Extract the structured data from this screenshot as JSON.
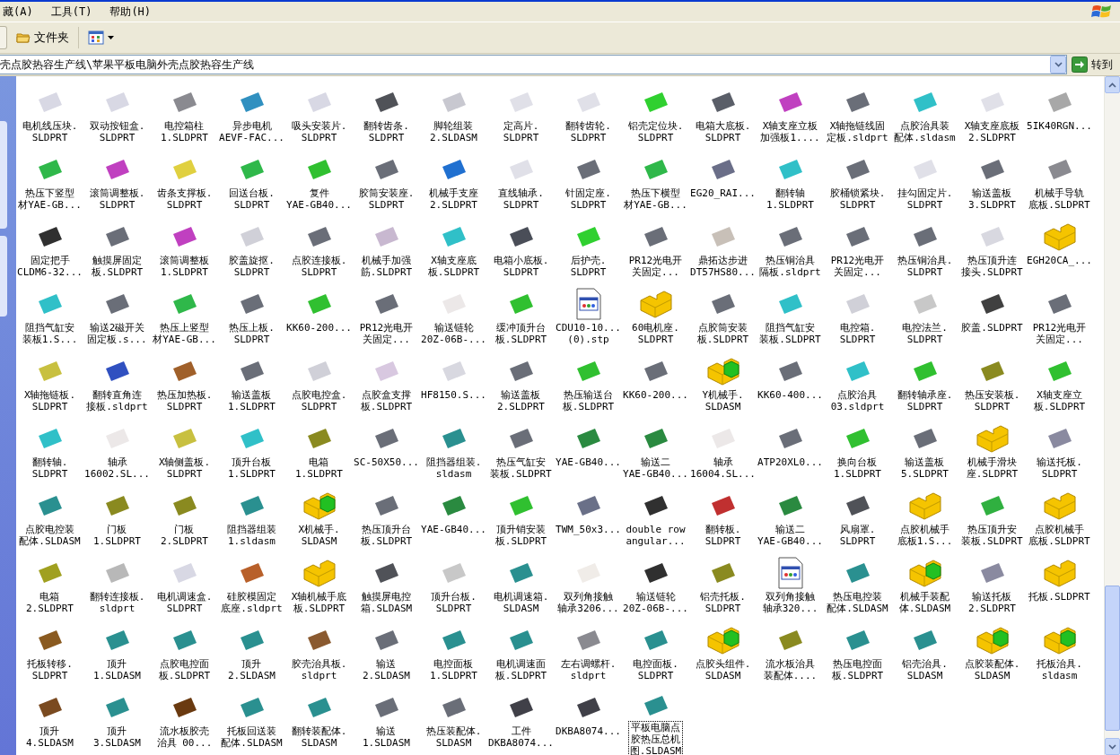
{
  "menu": [
    "藏(A)",
    "工具(T)",
    "帮助(H)"
  ],
  "toolbar": {
    "folders_label": "文件夹"
  },
  "address": {
    "value": "壳点胶热容生产线\\苹果平板电脑外壳点胶热容生产线",
    "go_label": "转到"
  },
  "files": [
    {
      "kind": "part",
      "color": "#d8d8e4",
      "lines": [
        "电机线压块.",
        "SLDPRT"
      ],
      "selected": false
    },
    {
      "kind": "part",
      "color": "#d8d8e4",
      "lines": [
        "双动按钮盒.",
        "SLDPRT"
      ],
      "selected": false
    },
    {
      "kind": "part",
      "color": "#8a8a90",
      "lines": [
        "电控箱柱",
        "1.SLDPRT"
      ],
      "selected": false
    },
    {
      "kind": "part",
      "color": "#3090c0",
      "lines": [
        "异步电机",
        "AEVF-FAC..."
      ],
      "selected": false
    },
    {
      "kind": "part",
      "color": "#d8d8e4",
      "lines": [
        "吸头安装片.",
        "SLDPRT"
      ],
      "selected": false
    },
    {
      "kind": "part",
      "color": "#505258",
      "lines": [
        "翻转齿条.",
        "SLDPRT"
      ],
      "selected": false
    },
    {
      "kind": "part",
      "color": "#c8c8d0",
      "lines": [
        "脚轮组装",
        "2.SLDASM"
      ],
      "selected": false
    },
    {
      "kind": "part",
      "color": "#e0e0e8",
      "lines": [
        "定高片.",
        "SLDPRT"
      ],
      "selected": false
    },
    {
      "kind": "part",
      "color": "#e0e0e8",
      "lines": [
        "翻转齿轮.",
        "SLDPRT"
      ],
      "selected": false
    },
    {
      "kind": "part",
      "color": "#30d030",
      "lines": [
        "铝壳定位块.",
        "SLDPRT"
      ],
      "selected": false
    },
    {
      "kind": "part",
      "color": "#5a5e68",
      "lines": [
        "电箱大底板.",
        "SLDPRT"
      ],
      "selected": false
    },
    {
      "kind": "part",
      "color": "#c040c0",
      "lines": [
        "X轴支座立板",
        "加强板1...."
      ],
      "selected": false
    },
    {
      "kind": "part",
      "color": "#6a6e78",
      "lines": [
        "X轴拖链线固",
        "定板.sldprt"
      ],
      "selected": false
    },
    {
      "kind": "part",
      "color": "#30c0c8",
      "lines": [
        "点胶治具装",
        "配体.sldasm"
      ],
      "selected": false
    },
    {
      "kind": "part",
      "color": "#e0e0e8",
      "lines": [
        "X轴支座底板",
        "2.SLDPRT"
      ],
      "selected": false
    },
    {
      "kind": "part",
      "color": "#a8a8a8",
      "lines": [
        "5IK40RGN..."
      ],
      "selected": false
    },
    {
      "kind": "part",
      "color": "#2fb84a",
      "lines": [
        "热压下竖型",
        "材YAE-GB..."
      ],
      "selected": false
    },
    {
      "kind": "part",
      "color": "#c040c0",
      "lines": [
        "滚筒调整板.",
        "SLDPRT"
      ],
      "selected": false
    },
    {
      "kind": "part",
      "color": "#e0d040",
      "lines": [
        "齿条支撑板.",
        "SLDPRT"
      ],
      "selected": false
    },
    {
      "kind": "part",
      "color": "#2fb84a",
      "lines": [
        "回送台板.",
        "SLDPRT"
      ],
      "selected": false
    },
    {
      "kind": "part",
      "color": "#30c030",
      "lines": [
        "复件",
        "YAE-GB40..."
      ],
      "selected": false
    },
    {
      "kind": "part",
      "color": "#6a6e78",
      "lines": [
        "胶筒安装座.",
        "SLDPRT"
      ],
      "selected": false
    },
    {
      "kind": "part",
      "color": "#2070d0",
      "lines": [
        "机械手支座",
        "2.SLDPRT"
      ],
      "selected": false
    },
    {
      "kind": "part",
      "color": "#e0e0e8",
      "lines": [
        "直线轴承.",
        "SLDPRT"
      ],
      "selected": false
    },
    {
      "kind": "part",
      "color": "#6a6e78",
      "lines": [
        "针固定座.",
        "SLDPRT"
      ],
      "selected": false
    },
    {
      "kind": "part",
      "color": "#2fb84a",
      "lines": [
        "热压下横型",
        "材YAE-GB..."
      ],
      "selected": false
    },
    {
      "kind": "part",
      "color": "#6a6e88",
      "lines": [
        "EG20_RAI..."
      ],
      "selected": false
    },
    {
      "kind": "part",
      "color": "#30c0c8",
      "lines": [
        "翻转轴",
        "1.SLDPRT"
      ],
      "selected": false
    },
    {
      "kind": "part",
      "color": "#6a6e78",
      "lines": [
        "胶桶锁紧块.",
        "SLDPRT"
      ],
      "selected": false
    },
    {
      "kind": "part",
      "color": "#e0e0e8",
      "lines": [
        "挂勾固定片.",
        "SLDPRT"
      ],
      "selected": false
    },
    {
      "kind": "part",
      "color": "#6a6e78",
      "lines": [
        "输送盖板",
        "3.SLDPRT"
      ],
      "selected": false
    },
    {
      "kind": "part",
      "color": "#8a8a90",
      "lines": [
        "机械手导轨",
        "底板.SLDPRT"
      ],
      "selected": false
    },
    {
      "kind": "part",
      "color": "#303030",
      "lines": [
        "固定把手",
        "CLDM6-32..."
      ],
      "selected": false
    },
    {
      "kind": "part",
      "color": "#6a6e78",
      "lines": [
        "触摸屏固定",
        "板.SLDPRT"
      ],
      "selected": false
    },
    {
      "kind": "part",
      "color": "#c040c0",
      "lines": [
        "滚筒调整板",
        "1.SLDPRT"
      ],
      "selected": false
    },
    {
      "kind": "part",
      "color": "#d0d0d8",
      "lines": [
        "胶盖旋抠.",
        "SLDPRT"
      ],
      "selected": false
    },
    {
      "kind": "part",
      "color": "#6a6e78",
      "lines": [
        "点胶连接板.",
        "SLDPRT"
      ],
      "selected": false
    },
    {
      "kind": "part",
      "color": "#c8b8d0",
      "lines": [
        "机械手加强",
        "筋.SLDPRT"
      ],
      "selected": false
    },
    {
      "kind": "part",
      "color": "#30c0c8",
      "lines": [
        "X轴支座底",
        "板.SLDPRT"
      ],
      "selected": false
    },
    {
      "kind": "part",
      "color": "#4a4e58",
      "lines": [
        "电箱小底板.",
        "SLDPRT"
      ],
      "selected": false
    },
    {
      "kind": "part",
      "color": "#30d030",
      "lines": [
        "后护壳.",
        "SLDPRT"
      ],
      "selected": false
    },
    {
      "kind": "part",
      "color": "#6a6e78",
      "lines": [
        "PR12光电开",
        "关固定..."
      ],
      "selected": false
    },
    {
      "kind": "part",
      "color": "#c8c0b8",
      "lines": [
        "鼎拓达步进",
        "DT57HS80..."
      ],
      "selected": false
    },
    {
      "kind": "part",
      "color": "#6a6e78",
      "lines": [
        "热压铜治具",
        "隔板.sldprt"
      ],
      "selected": false
    },
    {
      "kind": "part",
      "color": "#6a6e78",
      "lines": [
        "PR12光电开",
        "关固定..."
      ],
      "selected": false
    },
    {
      "kind": "part",
      "color": "#6a6e78",
      "lines": [
        "热压铜治具.",
        "SLDPRT"
      ],
      "selected": false
    },
    {
      "kind": "part",
      "color": "#d8d8e0",
      "lines": [
        "热压顶升连",
        "接头.SLDPRT"
      ],
      "selected": false
    },
    {
      "kind": "block",
      "lines": [
        "EGH20CA_..."
      ],
      "selected": false
    },
    {
      "kind": "part",
      "color": "#30c0c8",
      "lines": [
        "阻挡气缸安",
        "装板1.S..."
      ],
      "selected": false
    },
    {
      "kind": "part",
      "color": "#6a6e78",
      "lines": [
        "输送2磁开关",
        "固定板.s..."
      ],
      "selected": false
    },
    {
      "kind": "part",
      "color": "#2fb84a",
      "lines": [
        "热压上竖型",
        "材YAE-GB..."
      ],
      "selected": false
    },
    {
      "kind": "part",
      "color": "#6a6e78",
      "lines": [
        "热压上板.",
        "SLDPRT"
      ],
      "selected": false
    },
    {
      "kind": "part",
      "color": "#30c030",
      "lines": [
        "KK60-200..."
      ],
      "selected": false
    },
    {
      "kind": "part",
      "color": "#6a6e78",
      "lines": [
        "PR12光电开",
        "关固定..."
      ],
      "selected": false
    },
    {
      "kind": "part",
      "color": "#ece8e8",
      "lines": [
        "输送链轮",
        "20Z-06B-..."
      ],
      "selected": false
    },
    {
      "kind": "part",
      "color": "#30c030",
      "lines": [
        "缓冲顶升台",
        "板.SLDPRT"
      ],
      "selected": false
    },
    {
      "kind": "document",
      "lines": [
        "CDU10-10...",
        "(0).stp"
      ],
      "selected": false
    },
    {
      "kind": "block",
      "lines": [
        "60电机座.",
        "SLDPRT"
      ],
      "selected": false
    },
    {
      "kind": "part",
      "color": "#6a6e78",
      "lines": [
        "点胶筒安装",
        "板.SLDPRT"
      ],
      "selected": false
    },
    {
      "kind": "part",
      "color": "#30c0c8",
      "lines": [
        "阻挡气缸安",
        "装板.SLDPRT"
      ],
      "selected": false
    },
    {
      "kind": "part",
      "color": "#d0d0d8",
      "lines": [
        "电控箱.",
        "SLDPRT"
      ],
      "selected": false
    },
    {
      "kind": "part",
      "color": "#c8c8c8",
      "lines": [
        "电控法兰.",
        "SLDPRT"
      ],
      "selected": false
    },
    {
      "kind": "part",
      "color": "#404040",
      "lines": [
        "胶盖.SLDPRT"
      ],
      "selected": false
    },
    {
      "kind": "part",
      "color": "#6a6e78",
      "lines": [
        "PR12光电开",
        "关固定..."
      ],
      "selected": false
    },
    {
      "kind": "part",
      "color": "#c8c040",
      "lines": [
        "X轴拖链板.",
        "SLDPRT"
      ],
      "selected": false
    },
    {
      "kind": "part",
      "color": "#3050c0",
      "lines": [
        "翻转直角连",
        "接板.sldprt"
      ],
      "selected": false
    },
    {
      "kind": "part",
      "color": "#a0602a",
      "lines": [
        "热压加热板.",
        "SLDPRT"
      ],
      "selected": false
    },
    {
      "kind": "part",
      "color": "#6a6e78",
      "lines": [
        "输送盖板",
        "1.SLDPRT"
      ],
      "selected": false
    },
    {
      "kind": "part",
      "color": "#d0d0d8",
      "lines": [
        "点胶电控盒.",
        "SLDPRT"
      ],
      "selected": false
    },
    {
      "kind": "part",
      "color": "#d8c8e0",
      "lines": [
        "点胶盒支撑",
        "板.SLDPRT"
      ],
      "selected": false
    },
    {
      "kind": "part",
      "color": "#d8d8e0",
      "lines": [
        "HF8150.S..."
      ],
      "selected": false
    },
    {
      "kind": "part",
      "color": "#6a6e78",
      "lines": [
        "输送盖板",
        "2.SLDPRT"
      ],
      "selected": false
    },
    {
      "kind": "part",
      "color": "#30c030",
      "lines": [
        "热压输送台",
        "板.SLDPRT"
      ],
      "selected": false
    },
    {
      "kind": "part",
      "color": "#6a6e78",
      "lines": [
        "KK60-200..."
      ],
      "selected": false
    },
    {
      "kind": "assembly",
      "lines": [
        "Y机械手.",
        "SLDASM"
      ],
      "selected": false
    },
    {
      "kind": "part",
      "color": "#6a6e78",
      "lines": [
        "KK60-400..."
      ],
      "selected": false
    },
    {
      "kind": "part",
      "color": "#30c0c8",
      "lines": [
        "点胶治具",
        "03.sldprt"
      ],
      "selected": false
    },
    {
      "kind": "part",
      "color": "#30c030",
      "lines": [
        "翻转轴承座.",
        "SLDPRT"
      ],
      "selected": false
    },
    {
      "kind": "part",
      "color": "#8a8a20",
      "lines": [
        "热压安装板.",
        "SLDPRT"
      ],
      "selected": false
    },
    {
      "kind": "part",
      "color": "#30c030",
      "lines": [
        "X轴支座立",
        "板.SLDPRT"
      ],
      "selected": false
    },
    {
      "kind": "part",
      "color": "#30c0c8",
      "lines": [
        "翻转轴.",
        "SLDPRT"
      ],
      "selected": false
    },
    {
      "kind": "part",
      "color": "#ece8e8",
      "lines": [
        "轴承",
        "16002.SL..."
      ],
      "selected": false
    },
    {
      "kind": "part",
      "color": "#c8c040",
      "lines": [
        "X轴侧盖板.",
        "SLDPRT"
      ],
      "selected": false
    },
    {
      "kind": "part",
      "color": "#30c0c8",
      "lines": [
        "顶升台板",
        "1.SLDPRT"
      ],
      "selected": false
    },
    {
      "kind": "part",
      "color": "#8a8a20",
      "lines": [
        "电箱",
        "1.SLDPRT"
      ],
      "selected": false
    },
    {
      "kind": "part",
      "color": "#6a6e78",
      "lines": [
        "SC-50X50..."
      ],
      "selected": false
    },
    {
      "kind": "part",
      "color": "#2a9090",
      "lines": [
        "阻挡器组装.",
        "sldasm"
      ],
      "selected": false
    },
    {
      "kind": "part",
      "color": "#6a6e78",
      "lines": [
        "热压气缸安",
        "装板.SLDPRT"
      ],
      "selected": false
    },
    {
      "kind": "part",
      "color": "#2a8a40",
      "lines": [
        "YAE-GB40..."
      ],
      "selected": false
    },
    {
      "kind": "part",
      "color": "#2a8a40",
      "lines": [
        "输送二",
        "YAE-GB40..."
      ],
      "selected": false
    },
    {
      "kind": "part",
      "color": "#ece8e8",
      "lines": [
        "轴承",
        "16004.SL..."
      ],
      "selected": false
    },
    {
      "kind": "part",
      "color": "#6a6e78",
      "lines": [
        "ATP20XL0..."
      ],
      "selected": false
    },
    {
      "kind": "part",
      "color": "#30c030",
      "lines": [
        "换向台板",
        "1.SLDPRT"
      ],
      "selected": false
    },
    {
      "kind": "part",
      "color": "#6a6e78",
      "lines": [
        "输送盖板",
        "5.SLDPRT"
      ],
      "selected": false
    },
    {
      "kind": "block",
      "lines": [
        "机械手滑块",
        "座.SLDPRT"
      ],
      "selected": false
    },
    {
      "kind": "part",
      "color": "#8a8aa0",
      "lines": [
        "输送托板.",
        "SLDPRT"
      ],
      "selected": false
    },
    {
      "kind": "part",
      "color": "#2a9090",
      "lines": [
        "点胶电控装",
        "配体.SLDASM"
      ],
      "selected": false
    },
    {
      "kind": "part",
      "color": "#8a8a20",
      "lines": [
        "门板",
        "1.SLDPRT"
      ],
      "selected": false
    },
    {
      "kind": "part",
      "color": "#8a8a20",
      "lines": [
        "门板",
        "2.SLDPRT"
      ],
      "selected": false
    },
    {
      "kind": "part",
      "color": "#2a9090",
      "lines": [
        "阻挡器组装",
        "1.sldasm"
      ],
      "selected": false
    },
    {
      "kind": "assembly",
      "lines": [
        "X机械手.",
        "SLDASM"
      ],
      "selected": false
    },
    {
      "kind": "part",
      "color": "#6a6e78",
      "lines": [
        "热压顶升台",
        "板.SLDPRT"
      ],
      "selected": false
    },
    {
      "kind": "part",
      "color": "#2a8a40",
      "lines": [
        "YAE-GB40..."
      ],
      "selected": false
    },
    {
      "kind": "part",
      "color": "#30c030",
      "lines": [
        "顶升销安装",
        "板.SLDPRT"
      ],
      "selected": false
    },
    {
      "kind": "part",
      "color": "#6a7088",
      "lines": [
        "TWM_50x3..."
      ],
      "selected": false
    },
    {
      "kind": "part",
      "color": "#303030",
      "lines": [
        "double row",
        "angular..."
      ],
      "selected": false
    },
    {
      "kind": "part",
      "color": "#c03030",
      "lines": [
        "翻转板.",
        "SLDPRT"
      ],
      "selected": false
    },
    {
      "kind": "part",
      "color": "#2a8a40",
      "lines": [
        "输送二",
        "YAE-GB40..."
      ],
      "selected": false
    },
    {
      "kind": "part",
      "color": "#505258",
      "lines": [
        "风扇罩.",
        "SLDPRT"
      ],
      "selected": false
    },
    {
      "kind": "block",
      "lines": [
        "点胶机械手",
        "底板1.S..."
      ],
      "selected": false
    },
    {
      "kind": "part",
      "color": "#30b040",
      "lines": [
        "热压顶升安",
        "装板.SLDPRT"
      ],
      "selected": false
    },
    {
      "kind": "block",
      "lines": [
        "点胶机械手",
        "底板.SLDPRT"
      ],
      "selected": false
    },
    {
      "kind": "part",
      "color": "#a0a020",
      "lines": [
        "电箱",
        "2.SLDPRT"
      ],
      "selected": false
    },
    {
      "kind": "part",
      "color": "#b8b8b8",
      "lines": [
        "翻转连接板.",
        "sldprt"
      ],
      "selected": false
    },
    {
      "kind": "part",
      "color": "#d8d8e4",
      "lines": [
        "电机调速盒.",
        "SLDPRT"
      ],
      "selected": false
    },
    {
      "kind": "part",
      "color": "#b8602a",
      "lines": [
        "硅胶模固定",
        "底座.sldprt"
      ],
      "selected": false
    },
    {
      "kind": "block",
      "lines": [
        "X轴机械手底",
        "板.SLDPRT"
      ],
      "selected": false
    },
    {
      "kind": "part",
      "color": "#505258",
      "lines": [
        "触摸屏电控",
        "箱.SLDASM"
      ],
      "selected": false
    },
    {
      "kind": "part",
      "color": "#c8c8c8",
      "lines": [
        "顶升台板.",
        "SLDPRT"
      ],
      "selected": false
    },
    {
      "kind": "part",
      "color": "#2a9090",
      "lines": [
        "电机调速箱.",
        "SLDASM"
      ],
      "selected": false
    },
    {
      "kind": "part",
      "color": "#f0ece8",
      "lines": [
        "双列角接触",
        "轴承3206..."
      ],
      "selected": false
    },
    {
      "kind": "part",
      "color": "#303030",
      "lines": [
        "输送链轮",
        "20Z-06B-..."
      ],
      "selected": false
    },
    {
      "kind": "part",
      "color": "#8a8a20",
      "lines": [
        "铝壳托板.",
        "SLDPRT"
      ],
      "selected": false
    },
    {
      "kind": "document",
      "lines": [
        "双列角接触",
        "轴承320..."
      ],
      "selected": false
    },
    {
      "kind": "part",
      "color": "#2a9090",
      "lines": [
        "热压电控装",
        "配体.SLDASM"
      ],
      "selected": false
    },
    {
      "kind": "assembly",
      "lines": [
        "机械手装配",
        "体.SLDASM"
      ],
      "selected": false
    },
    {
      "kind": "part",
      "color": "#8a8aa0",
      "lines": [
        "输送托板",
        "2.SLDPRT"
      ],
      "selected": false
    },
    {
      "kind": "block",
      "lines": [
        "托板.SLDPRT"
      ],
      "selected": false
    },
    {
      "kind": "part",
      "color": "#8a5a20",
      "lines": [
        "托板转移.",
        "SLDPRT"
      ],
      "selected": false
    },
    {
      "kind": "part",
      "color": "#2a9090",
      "lines": [
        "顶升",
        "1.SLDASM"
      ],
      "selected": false
    },
    {
      "kind": "part",
      "color": "#2a9090",
      "lines": [
        "点胶电控面",
        "板.SLDPRT"
      ],
      "selected": false
    },
    {
      "kind": "part",
      "color": "#2a9090",
      "lines": [
        "顶升",
        "2.SLDASM"
      ],
      "selected": false
    },
    {
      "kind": "part",
      "color": "#8a5a30",
      "lines": [
        "胶壳治具板.",
        "sldprt"
      ],
      "selected": false
    },
    {
      "kind": "part",
      "color": "#6a6e78",
      "lines": [
        "输送",
        "2.SLDASM"
      ],
      "selected": false
    },
    {
      "kind": "part",
      "color": "#2a9090",
      "lines": [
        "电控面板",
        "1.SLDPRT"
      ],
      "selected": false
    },
    {
      "kind": "part",
      "color": "#2a9090",
      "lines": [
        "电机调速面",
        "板.SLDPRT"
      ],
      "selected": false
    },
    {
      "kind": "part",
      "color": "#8a8a90",
      "lines": [
        "左右调螺杆.",
        "sldprt"
      ],
      "selected": false
    },
    {
      "kind": "part",
      "color": "#2a9090",
      "lines": [
        "电控面板.",
        "SLDPRT"
      ],
      "selected": false
    },
    {
      "kind": "assembly",
      "lines": [
        "点胶头组件.",
        "SLDASM"
      ],
      "selected": false
    },
    {
      "kind": "part",
      "color": "#8a8a20",
      "lines": [
        "流水板治具",
        "装配体...."
      ],
      "selected": false
    },
    {
      "kind": "part",
      "color": "#2a9090",
      "lines": [
        "热压电控面",
        "板.SLDPRT"
      ],
      "selected": false
    },
    {
      "kind": "part",
      "color": "#2a9090",
      "lines": [
        "铝壳治具.",
        "SLDASM"
      ],
      "selected": false
    },
    {
      "kind": "assembly",
      "lines": [
        "点胶装配体.",
        "SLDASM"
      ],
      "selected": false
    },
    {
      "kind": "assembly",
      "lines": [
        "托板治具.",
        "sldasm"
      ],
      "selected": false
    },
    {
      "kind": "part",
      "color": "#7a4a20",
      "lines": [
        "顶升",
        "4.SLDASM"
      ],
      "selected": false
    },
    {
      "kind": "part",
      "color": "#2a9090",
      "lines": [
        "顶升",
        "3.SLDASM"
      ],
      "selected": false
    },
    {
      "kind": "part",
      "color": "#6a3a10",
      "lines": [
        "流水板胶壳",
        "治具 00..."
      ],
      "selected": false
    },
    {
      "kind": "part",
      "color": "#2a9090",
      "lines": [
        "托板回送装",
        "配体.SLDASM"
      ],
      "selected": false
    },
    {
      "kind": "part",
      "color": "#2a9090",
      "lines": [
        "翻转装配体.",
        "SLDASM"
      ],
      "selected": false
    },
    {
      "kind": "part",
      "color": "#6a6e78",
      "lines": [
        "输送",
        "1.SLDASM"
      ],
      "selected": false
    },
    {
      "kind": "part",
      "color": "#6a6e78",
      "lines": [
        "热压装配体.",
        "SLDASM"
      ],
      "selected": false
    },
    {
      "kind": "part",
      "color": "#404048",
      "lines": [
        "工件",
        "DKBA8074..."
      ],
      "selected": false
    },
    {
      "kind": "part",
      "color": "#404048",
      "lines": [
        "DKBA8074..."
      ],
      "selected": false
    },
    {
      "kind": "part",
      "color": "#2a9090",
      "lines": [
        "平板电脑点",
        "胶热压总机",
        "图.SLDASM"
      ],
      "selected": true
    }
  ]
}
